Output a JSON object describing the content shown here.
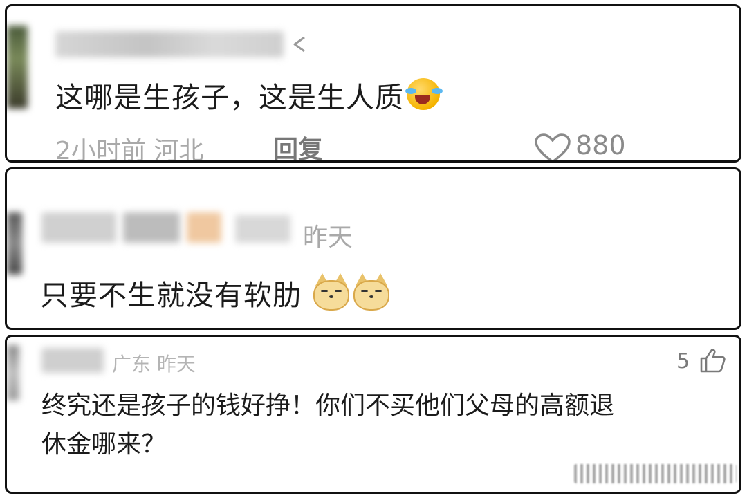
{
  "comments": [
    {
      "username": "",
      "text": "这哪是生孩子，这是生人质",
      "time": "2小时前",
      "location": "河北",
      "reply_label": "回复",
      "likes": "880",
      "emoji": "crying-laughing-emoji"
    },
    {
      "username": "",
      "time": "昨天",
      "text": "只要不生就没有软肋",
      "emoji": "cat-face-emoji"
    },
    {
      "username": "",
      "location": "广东",
      "time": "昨天",
      "likes": "5",
      "text_line1": "终究还是孩子的钱好挣！你们不买他们父母的高额退",
      "text_line2": "休金哪来？"
    }
  ],
  "colors": {
    "card_border": "#111111",
    "meta_text": "#a9a9a9",
    "comment_text": "#1b1b1b"
  }
}
